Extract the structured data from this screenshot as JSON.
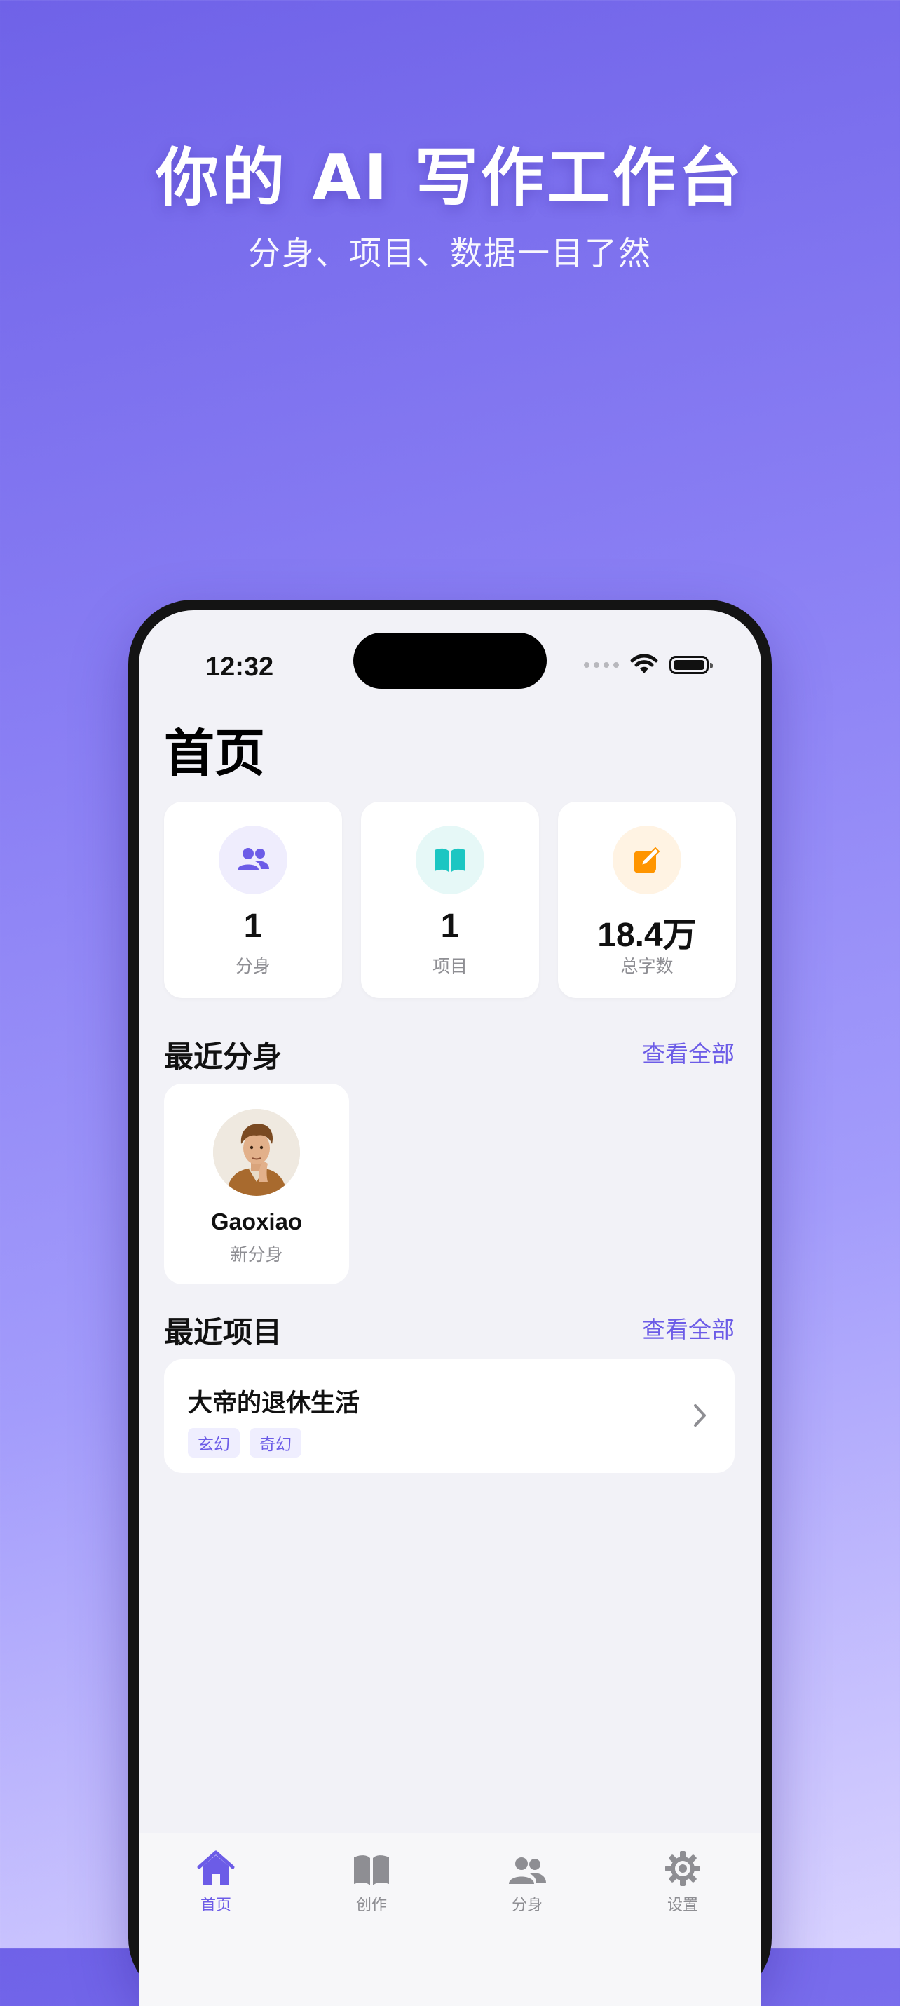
{
  "promo": {
    "title": "你的 AI 写作工作台",
    "subtitle": "分身、项目、数据一目了然"
  },
  "status_bar": {
    "time": "12:32"
  },
  "page": {
    "title": "首页"
  },
  "stats": [
    {
      "value": "1",
      "label": "分身",
      "icon": "people-icon",
      "color": "#6c5ce7",
      "bg": "#efedfd"
    },
    {
      "value": "1",
      "label": "项目",
      "icon": "book-icon",
      "color": "#1cc6c2",
      "bg": "#e6f8f7"
    },
    {
      "value": "18.4万",
      "label": "总字数",
      "icon": "edit-icon",
      "color": "#ff9500",
      "bg": "#fff3e3"
    }
  ],
  "recent_personas": {
    "title": "最近分身",
    "view_all": "查看全部",
    "items": [
      {
        "name": "Gaoxiao",
        "desc": "新分身"
      }
    ]
  },
  "recent_projects": {
    "title": "最近项目",
    "view_all": "查看全部",
    "items": [
      {
        "name": "大帝的退休生活",
        "tags": [
          "玄幻",
          "奇幻"
        ]
      }
    ]
  },
  "tabbar": {
    "active": 0,
    "tabs": [
      {
        "label": "首页",
        "icon": "home-icon"
      },
      {
        "label": "创作",
        "icon": "book-open-icon"
      },
      {
        "label": "分身",
        "icon": "people-icon"
      },
      {
        "label": "设置",
        "icon": "gear-icon"
      }
    ]
  },
  "colors": {
    "accent": "#6c5ce7",
    "inactive": "#8e8e93"
  }
}
